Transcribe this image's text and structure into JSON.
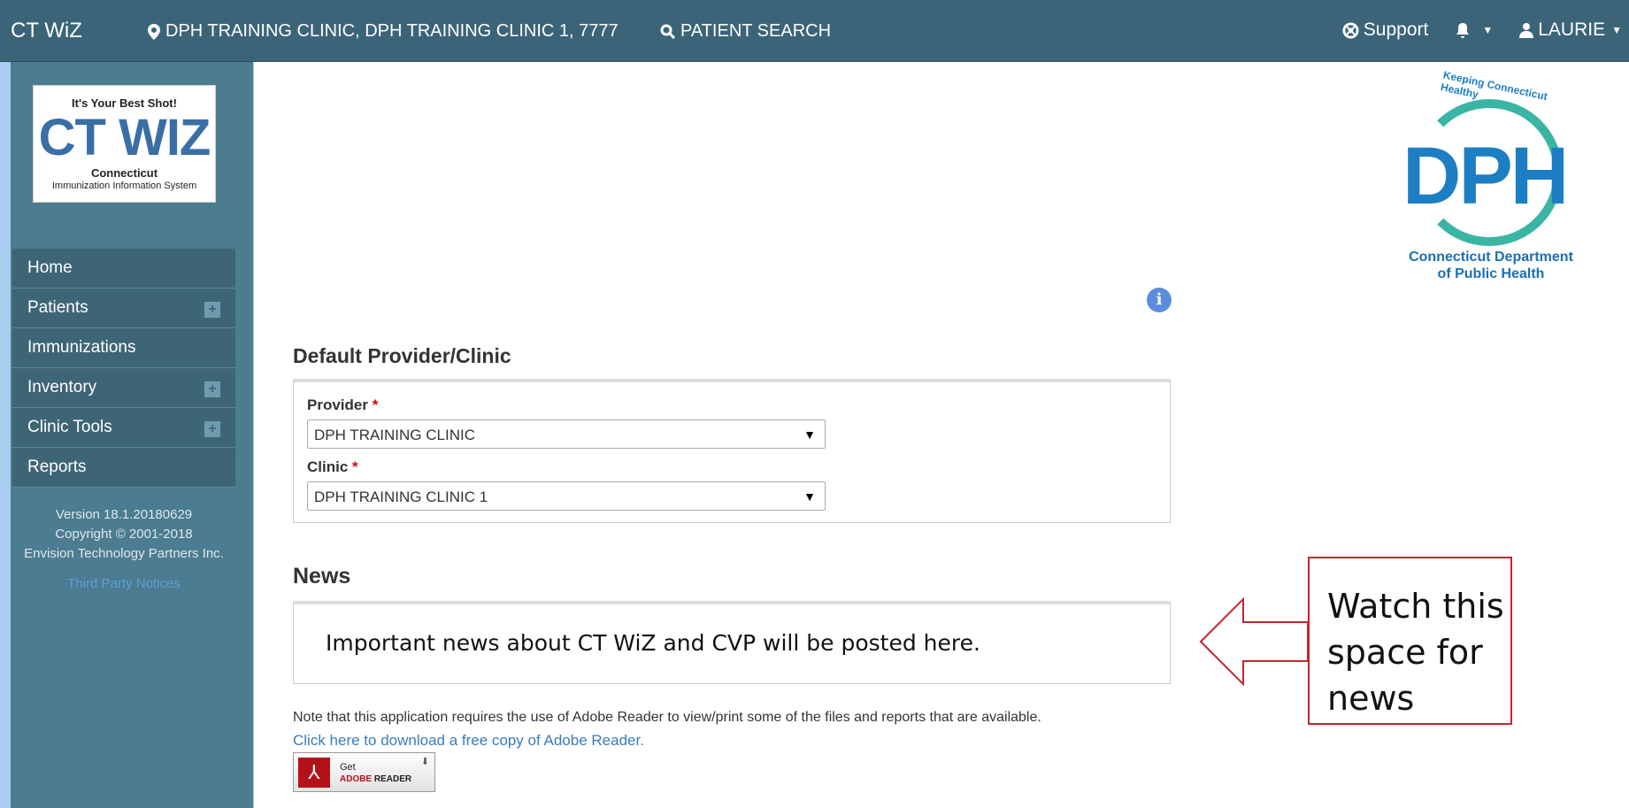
{
  "topbar": {
    "brand": "CT WiZ",
    "location": "DPH TRAINING CLINIC, DPH TRAINING CLINIC 1, 7777",
    "patient_search": "PATIENT SEARCH",
    "support": "Support",
    "user": "LAURIE"
  },
  "sidebar": {
    "logo": {
      "tagline": "It's Your Best Shot!",
      "main": "CT WIZ",
      "sub1": "Connecticut",
      "sub2": "Immunization Information System"
    },
    "items": [
      {
        "label": "Home",
        "expandable": false
      },
      {
        "label": "Patients",
        "expandable": true
      },
      {
        "label": "Immunizations",
        "expandable": false
      },
      {
        "label": "Inventory",
        "expandable": true
      },
      {
        "label": "Clinic Tools",
        "expandable": true
      },
      {
        "label": "Reports",
        "expandable": false
      }
    ],
    "version": "Version 18.1.20180629",
    "copyright": "Copyright © 2001-2018",
    "company": "Envision Technology Partners Inc.",
    "third_party": "Third Party Notices"
  },
  "main": {
    "default_heading": "Default Provider/Clinic",
    "provider_label": "Provider",
    "provider_value": "DPH TRAINING CLINIC",
    "clinic_label": "Clinic",
    "clinic_value": "DPH TRAINING CLINIC 1",
    "required_mark": "*",
    "news_heading": "News",
    "news_text": "Important news about CT WiZ and CVP will be posted here.",
    "adobe_note": "Note that this application requires the use of Adobe Reader to view/print some of the files and reports that are available.",
    "adobe_link": "Click here to download a free copy of Adobe Reader.",
    "adobe_badge_get": "Get",
    "adobe_badge_adobe": "ADOBE",
    "adobe_badge_reader": "READER"
  },
  "dph_logo": {
    "arc_text": "Keeping Connecticut Healthy",
    "letters": "DPH",
    "line1": "Connecticut Department",
    "line2": "of Public Health"
  },
  "callout": {
    "text": "Watch this space for news"
  },
  "colors": {
    "nav_bg": "#3b6478",
    "sidebar_bg": "#4b7c8f",
    "menu_bg": "#3e6576",
    "link": "#3b7bbf",
    "callout_border": "#c0282d"
  }
}
